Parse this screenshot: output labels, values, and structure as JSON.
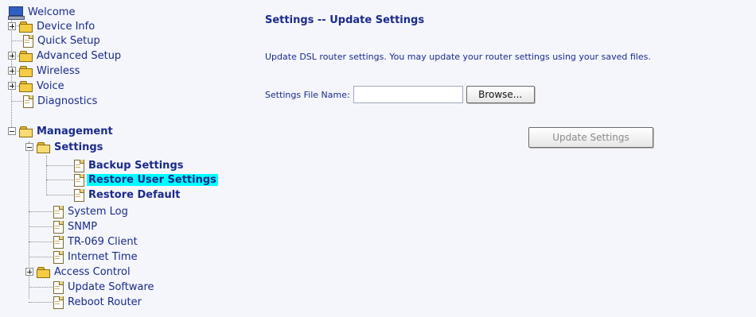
{
  "nav": {
    "root": "Welcome",
    "items": [
      {
        "label": "Device Info"
      },
      {
        "label": "Quick Setup"
      },
      {
        "label": "Advanced Setup"
      },
      {
        "label": "Wireless"
      },
      {
        "label": "Voice"
      },
      {
        "label": "Diagnostics"
      },
      {
        "label": "Management"
      },
      {
        "label": "Settings"
      },
      {
        "label": "Backup Settings"
      },
      {
        "label": "Restore User Settings"
      },
      {
        "label": "Restore Default"
      },
      {
        "label": "System Log"
      },
      {
        "label": "SNMP"
      },
      {
        "label": "TR-069 Client"
      },
      {
        "label": "Internet Time"
      },
      {
        "label": "Access Control"
      },
      {
        "label": "Update Software"
      },
      {
        "label": "Reboot Router"
      }
    ]
  },
  "main": {
    "title": "Settings -- Update Settings",
    "description": "Update DSL router settings. You may update your router settings using your saved files.",
    "file_label": "Settings File Name:",
    "file_value": "",
    "browse_label": "Browse...",
    "update_label": "Update Settings"
  },
  "colors": {
    "text": "#1a2a8a",
    "selected_bg": "#00ffff",
    "page_bg": "#f4f6fb"
  }
}
